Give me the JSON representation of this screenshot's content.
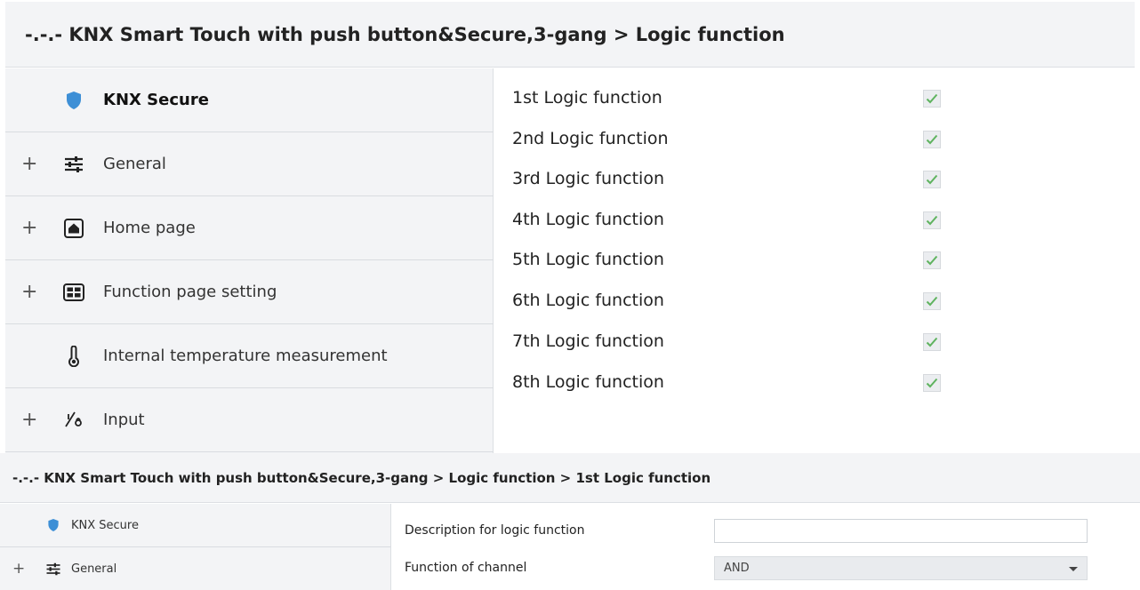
{
  "top": {
    "breadcrumb": "-.-.- KNX Smart Touch with push button&Secure,3-gang > Logic function",
    "sidebar": [
      {
        "label": "KNX Secure",
        "icon": "shield-icon",
        "expandable": false
      },
      {
        "label": "General",
        "icon": "sliders-icon",
        "expandable": true
      },
      {
        "label": "Home page",
        "icon": "home-icon",
        "expandable": true
      },
      {
        "label": "Function page setting",
        "icon": "grid-icon",
        "expandable": true
      },
      {
        "label": "Internal temperature measurement",
        "icon": "thermometer-icon",
        "expandable": false
      },
      {
        "label": "Input",
        "icon": "input-icon",
        "expandable": true
      }
    ],
    "logic_functions": [
      {
        "label": "1st Logic function",
        "checked": true
      },
      {
        "label": "2nd Logic function",
        "checked": true
      },
      {
        "label": "3rd Logic function",
        "checked": true
      },
      {
        "label": "4th Logic function",
        "checked": true
      },
      {
        "label": "5th Logic function",
        "checked": true
      },
      {
        "label": "6th Logic function",
        "checked": true
      },
      {
        "label": "7th Logic function",
        "checked": true
      },
      {
        "label": "8th Logic function",
        "checked": true
      }
    ]
  },
  "bottom": {
    "breadcrumb": "-.-.- KNX Smart Touch with push button&Secure,3-gang > Logic function > 1st Logic function",
    "sidebar": [
      {
        "label": "KNX Secure",
        "icon": "shield-icon",
        "expandable": false
      },
      {
        "label": "General",
        "icon": "sliders-icon",
        "expandable": true
      }
    ],
    "params": {
      "description_label": "Description for logic function",
      "description_value": "",
      "function_label": "Function of channel",
      "function_value": "AND"
    }
  },
  "colors": {
    "shield": "#3d8fd6",
    "check": "#5fb35f",
    "panel_bg": "#f3f4f6"
  },
  "plus_symbol": "+"
}
